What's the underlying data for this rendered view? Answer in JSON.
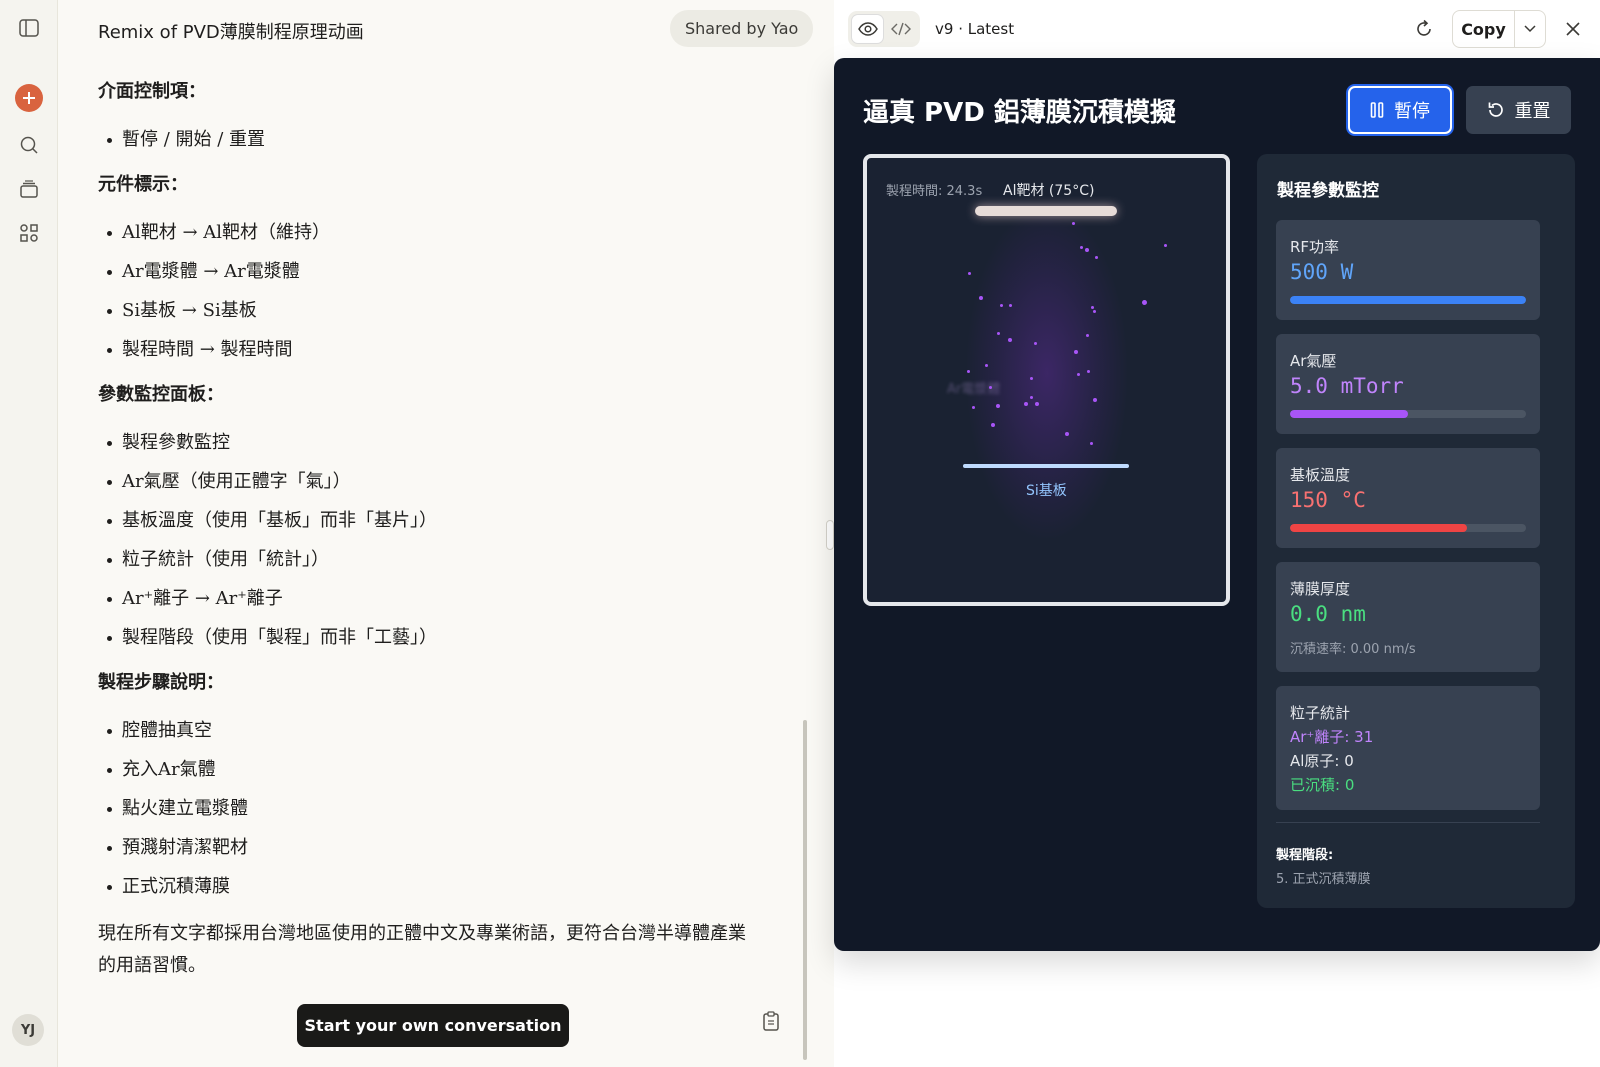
{
  "chat": {
    "title": "Remix of PVD薄膜制程原理动画",
    "shared_label": "Shared by Yao",
    "sections": [
      {
        "heading": "介面控制項：",
        "items": [
          "暫停 / 開始 / 重置"
        ]
      },
      {
        "heading": "元件標示：",
        "items": [
          "Al靶材 → Al靶材（維持）",
          "Ar電漿體 → Ar電漿體",
          "Si基板 → Si基板",
          "製程時間 → 製程時間"
        ]
      },
      {
        "heading": "參數監控面板：",
        "items": [
          "製程參數監控",
          "Ar氣壓（使用正體字「氣」）",
          "基板溫度（使用「基板」而非「基片」）",
          "粒子統計（使用「統計」）",
          "Ar⁺離子 → Ar⁺離子",
          "製程階段（使用「製程」而非「工藝」）"
        ]
      },
      {
        "heading": "製程步驟說明：",
        "items": [
          "腔體抽真空",
          "充入Ar氣體",
          "點火建立電漿體",
          "預濺射清潔靶材",
          "正式沉積薄膜"
        ]
      }
    ],
    "closing": "現在所有文字都採用台灣地區使用的正體中文及專業術語，更符合台灣半導體產業的用語習慣。",
    "start_button": "Start your own conversation",
    "avatar_initials": "YJ"
  },
  "artifact": {
    "version": "v9 · Latest",
    "copy_label": "Copy",
    "title": "逼真 PVD 鋁薄膜沉積模擬",
    "pause_label": "暫停",
    "reset_label": "重置",
    "chamber": {
      "process_time": "製程時間: 24.3s",
      "target_label": "Al靶材 (75°C)",
      "plasma_label": "Ar電漿體",
      "substrate_label": "Si基板"
    },
    "monitor": {
      "title": "製程參數監控",
      "rf_power": {
        "label": "RF功率",
        "value": "500 W",
        "fraction": 1.0,
        "color": "#3b82f6"
      },
      "ar_pressure": {
        "label": "Ar氣壓",
        "value": "5.0 mTorr",
        "fraction": 0.5,
        "color": "#a855f7"
      },
      "substrate_temp": {
        "label": "基板溫度",
        "value": "150 °C",
        "fraction": 0.75,
        "color": "#ef4444"
      },
      "film_thickness": {
        "label": "薄膜厚度",
        "value": "0.0 nm",
        "rate": "沉積速率: 0.00 nm/s",
        "color": "#4ade80"
      },
      "particles": {
        "label": "粒子統計",
        "ar_ions": "Ar⁺離子: 31",
        "al_atoms": "Al原子: 0",
        "deposited": "已沉積: 0"
      },
      "stage_label": "製程階段:",
      "stage_value": "5. 正式沉積薄膜"
    },
    "colors": {
      "accent": "#2563eb",
      "bg": "#111827",
      "panel": "#1f2937",
      "card": "#374151"
    }
  }
}
